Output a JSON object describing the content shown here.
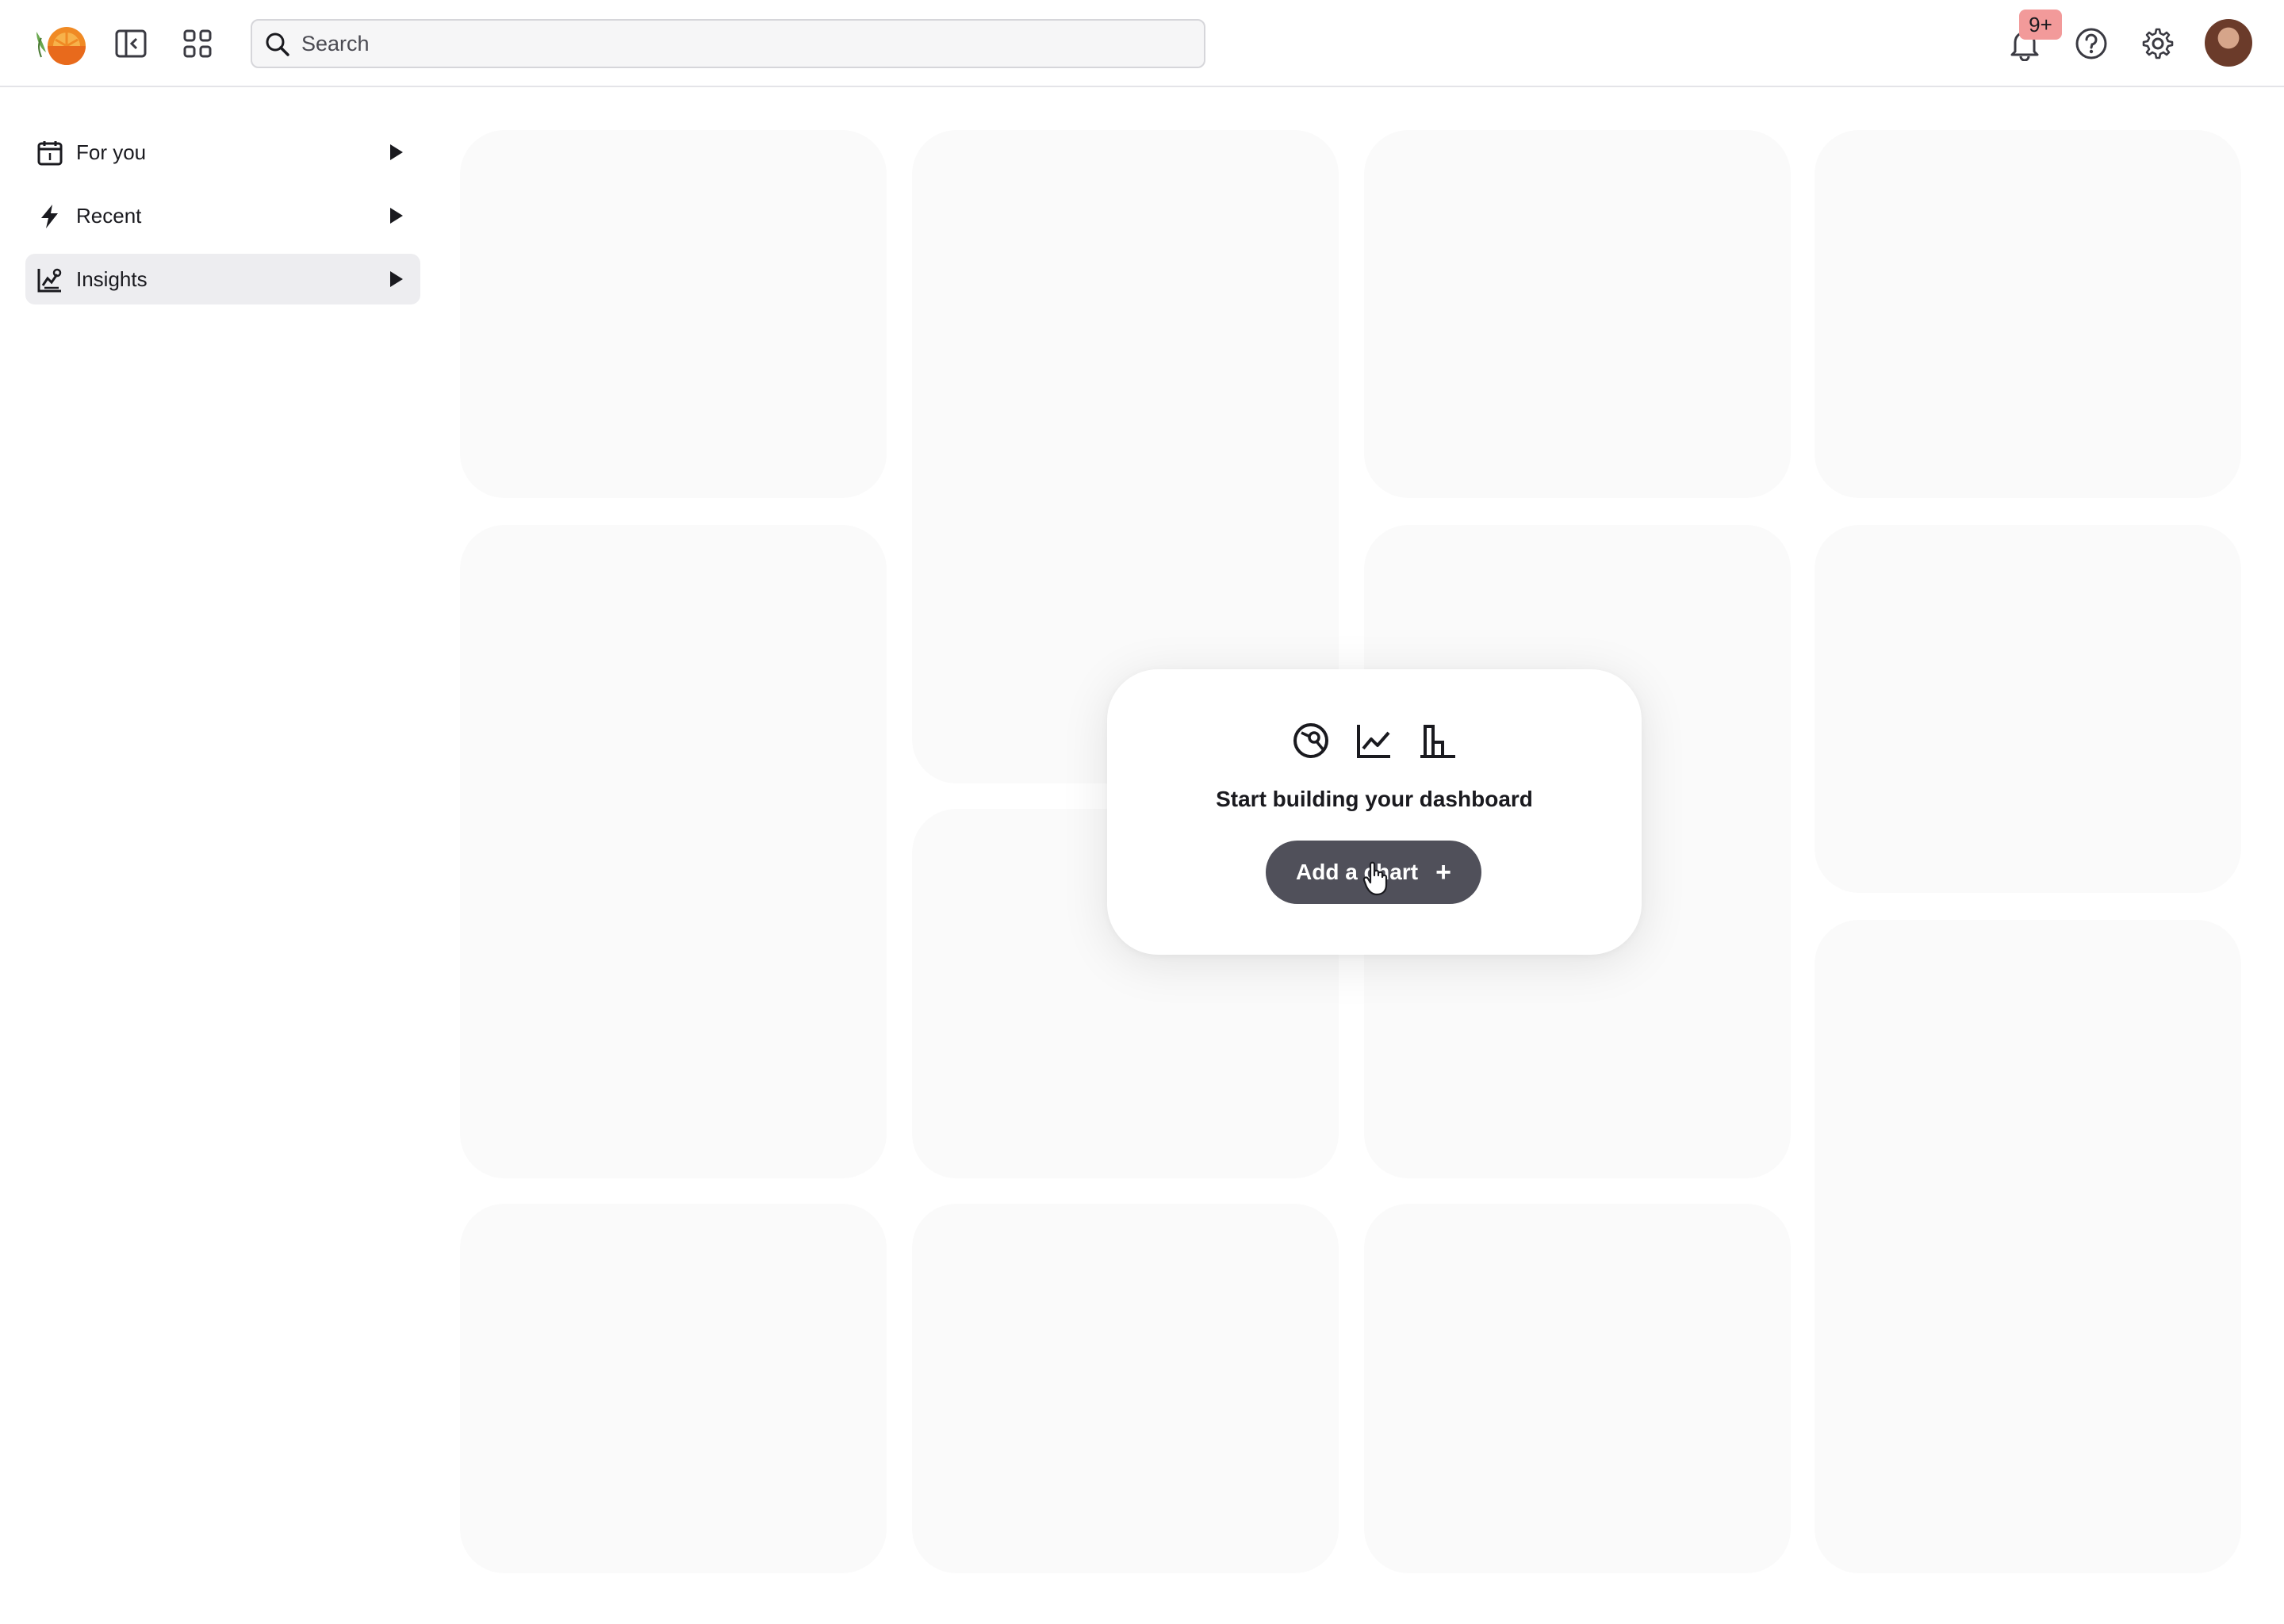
{
  "header": {
    "search_placeholder": "Search",
    "notification_badge": "9+",
    "icons": [
      "logo-icon",
      "sidebar-toggle-icon",
      "apps-grid-icon",
      "search-icon",
      "bell-icon",
      "help-icon",
      "gear-icon"
    ]
  },
  "sidebar": {
    "items": [
      {
        "label": "For you",
        "icon": "calendar-icon",
        "active": false
      },
      {
        "label": "Recent",
        "icon": "lightning-icon",
        "active": false
      },
      {
        "label": "Insights",
        "icon": "insights-icon",
        "active": true
      }
    ]
  },
  "empty_state": {
    "icons": [
      "pie-chart-icon",
      "line-chart-icon",
      "bar-chart-icon"
    ],
    "title": "Start building your dashboard",
    "button_label": "Add a chart",
    "button_icon": "plus-icon"
  },
  "colors": {
    "primary_button": "#50505a",
    "badge": "#f29a9a",
    "tile_background": "#fafafa",
    "active_nav": "#ededf0"
  }
}
